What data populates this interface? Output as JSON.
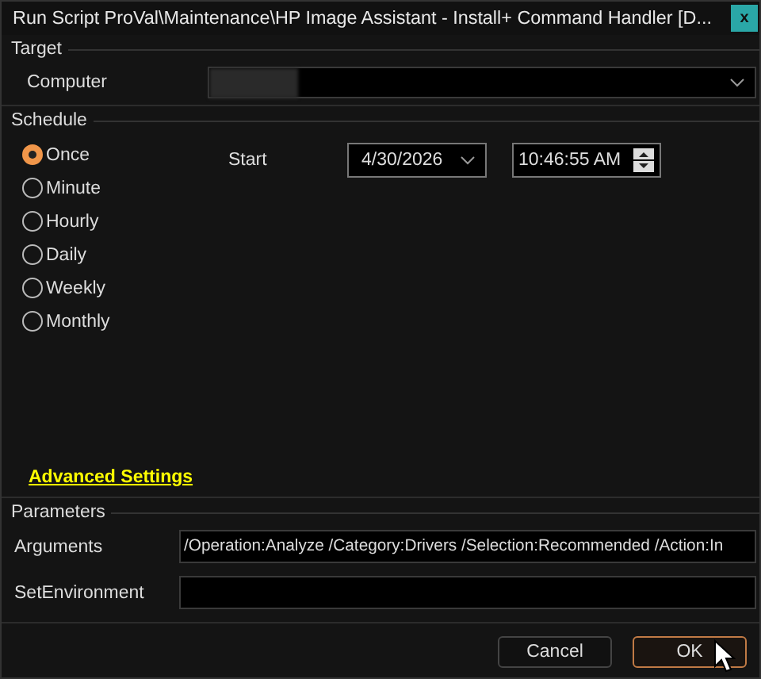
{
  "window": {
    "title": "Run Script ProVal\\Maintenance\\HP Image Assistant - Install+ Command Handler [D...",
    "close": "x"
  },
  "target": {
    "heading": "Target",
    "computer_label": "Computer"
  },
  "schedule": {
    "heading": "Schedule",
    "options": [
      {
        "label": "Once",
        "selected": true
      },
      {
        "label": "Minute",
        "selected": false
      },
      {
        "label": "Hourly",
        "selected": false
      },
      {
        "label": "Daily",
        "selected": false
      },
      {
        "label": "Weekly",
        "selected": false
      },
      {
        "label": "Monthly",
        "selected": false
      }
    ],
    "start_label": "Start",
    "date": "4/30/2026",
    "time": "10:46:55 AM"
  },
  "advanced_settings": "Advanced Settings",
  "parameters": {
    "heading": "Parameters",
    "rows": [
      {
        "label": "Arguments",
        "value": "/Operation:Analyze /Category:Drivers /Selection:Recommended /Action:In"
      },
      {
        "label": "SetEnvironment",
        "value": ""
      }
    ]
  },
  "buttons": [
    {
      "label": "Cancel",
      "kind": "secondary"
    },
    {
      "label": "OK",
      "kind": "primary"
    }
  ]
}
